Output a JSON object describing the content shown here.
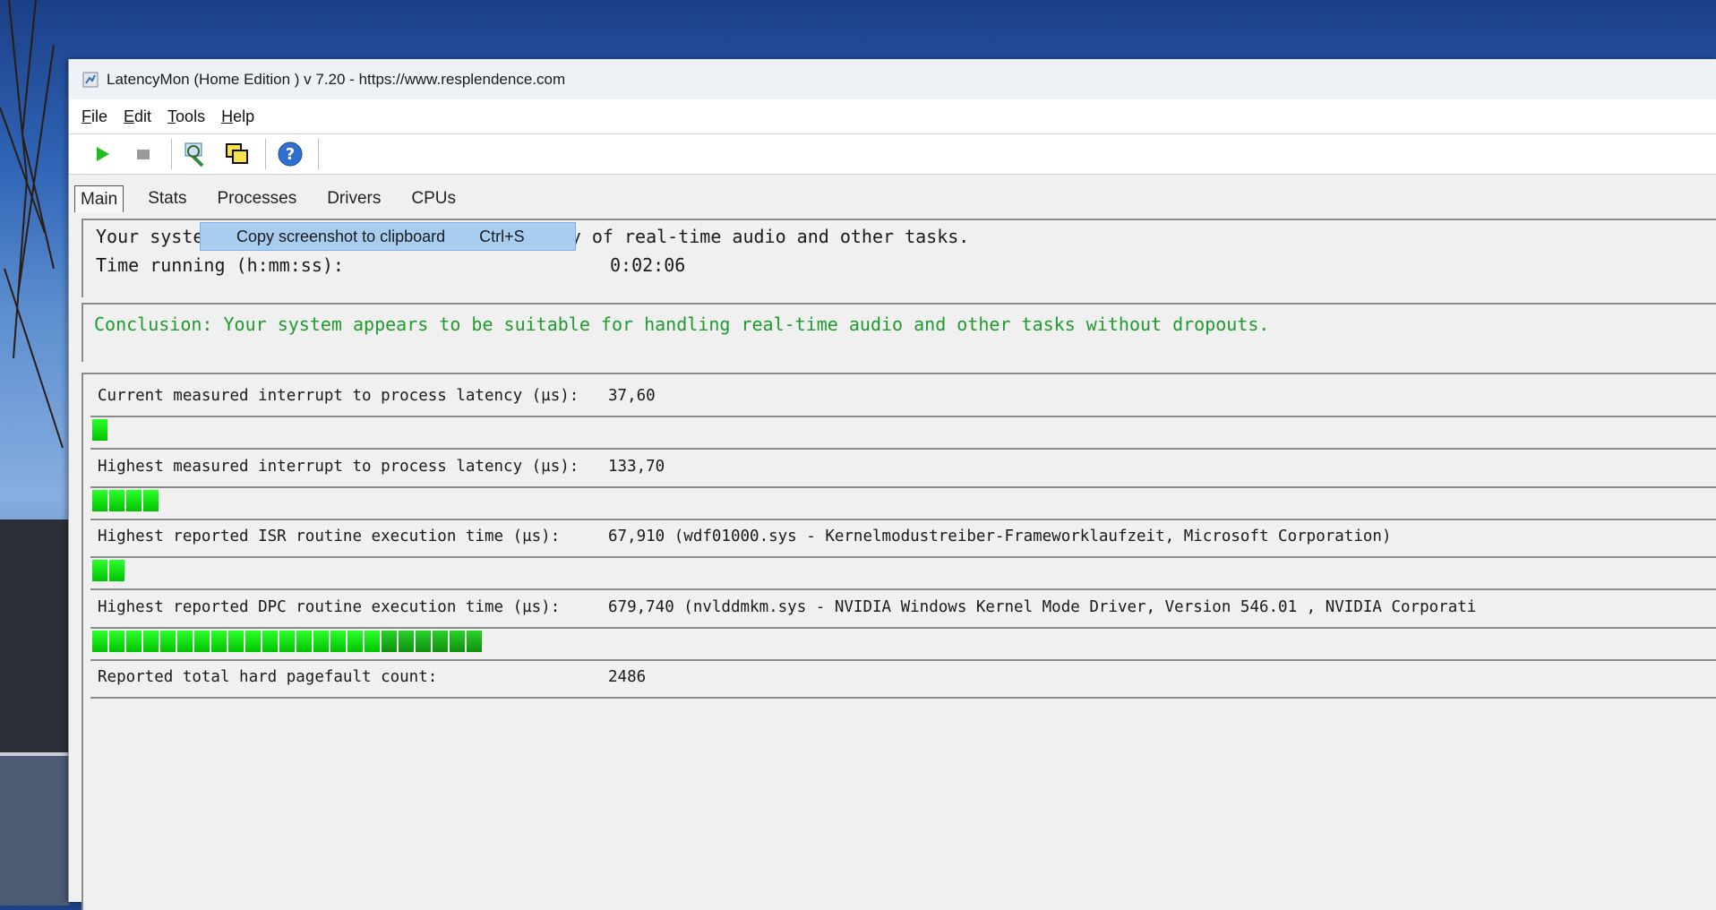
{
  "window": {
    "title": "LatencyMon  (Home Edition )  v 7.20 - https://www.resplendence.com"
  },
  "menu": {
    "items": [
      {
        "key": "F",
        "rest": "ile"
      },
      {
        "key": "E",
        "rest": "dit"
      },
      {
        "key": "T",
        "rest": "ools"
      },
      {
        "key": "H",
        "rest": "elp"
      }
    ]
  },
  "toolbar": {
    "icons": [
      "play-icon",
      "stop-icon",
      "analyze-icon",
      "screenshot-icon",
      "help-icon"
    ]
  },
  "tabs": [
    {
      "label": "Main",
      "active": true
    },
    {
      "label": "Stats",
      "active": false
    },
    {
      "label": "Processes",
      "active": false
    },
    {
      "label": "Drivers",
      "active": false
    },
    {
      "label": "CPUs",
      "active": false
    }
  ],
  "context_menu": {
    "label": "Copy screenshot to clipboard",
    "shortcut": "Ctrl+S"
  },
  "summary": {
    "analyzed_text": "Your system has been analyzed for suitability of real-time audio and other tasks.",
    "time_label": "Time running (h:mm:ss):",
    "time_value": "0:02:06"
  },
  "conclusion": {
    "text": "Conclusion: Your system appears to be suitable for handling real-time audio and other tasks without dropouts.",
    "color": "#1f9a2e"
  },
  "metrics": [
    {
      "label": "Current measured interrupt to process latency (µs):",
      "value": "37,60",
      "segments": 1
    },
    {
      "label": "Highest measured interrupt to process latency (µs):",
      "value": "133,70",
      "segments": 4
    },
    {
      "label": "Highest reported ISR routine execution time (µs):",
      "value": "67,910  (wdf01000.sys - Kernelmodustreiber-Frameworklaufzeit, Microsoft Corporation)",
      "segments": 2
    },
    {
      "label": "Highest reported DPC routine execution time (µs):",
      "value": "679,740  (nvlddmkm.sys - NVIDIA Windows Kernel Mode Driver, Version 546.01 , NVIDIA Corporati",
      "segments": 23
    },
    {
      "label": "Reported total hard pagefault count:",
      "value": "2486",
      "segments": 0
    }
  ]
}
